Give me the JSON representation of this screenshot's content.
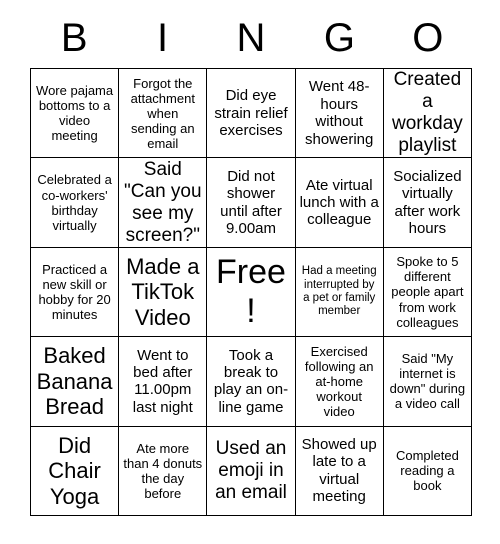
{
  "card": {
    "title": "BINGO",
    "header_letters": [
      "B",
      "I",
      "N",
      "G",
      "O"
    ],
    "colors": {
      "background": "#ffffff",
      "text": "#000000",
      "grid_line": "#000000"
    },
    "grid_size": "5x5",
    "free_space_index": 12,
    "cells": [
      {
        "text": "Wore pajama bottoms to a video meeting",
        "size": "sm"
      },
      {
        "text": "Forgot the attachment when sending an email",
        "size": "sm"
      },
      {
        "text": "Did eye strain relief exercises",
        "size": "md"
      },
      {
        "text": "Went 48-hours without showering",
        "size": "md"
      },
      {
        "text": "Created a workday playlist",
        "size": "lg"
      },
      {
        "text": "Celebrated a co-workers' birthday virtually",
        "size": "sm"
      },
      {
        "text": "Said \"Can you see my screen?\"",
        "size": "lg"
      },
      {
        "text": "Did not shower until after 9.00am",
        "size": "md"
      },
      {
        "text": "Ate virtual lunch with a colleague",
        "size": "md"
      },
      {
        "text": "Socialized virtually after work hours",
        "size": "md"
      },
      {
        "text": "Practiced a new skill or hobby for 20 minutes",
        "size": "sm"
      },
      {
        "text": "Made a TikTok Video",
        "size": "xl"
      },
      {
        "text": "Free!",
        "size": "xxl"
      },
      {
        "text": "Had a meeting interrupted by a pet or family member",
        "size": "xs"
      },
      {
        "text": "Spoke to 5 different people apart from work colleagues",
        "size": "sm"
      },
      {
        "text": "Baked Banana Bread",
        "size": "xl"
      },
      {
        "text": "Went to bed after 11.00pm last night",
        "size": "md"
      },
      {
        "text": "Took a break to play an on-line game",
        "size": "md"
      },
      {
        "text": "Exercised following an at-home workout video",
        "size": "sm"
      },
      {
        "text": "Said \"My internet is down\" during a video call",
        "size": "sm"
      },
      {
        "text": "Did Chair Yoga",
        "size": "xl"
      },
      {
        "text": "Ate more than 4 donuts the day before",
        "size": "sm"
      },
      {
        "text": "Used an emoji in an email",
        "size": "lg"
      },
      {
        "text": "Showed up late to a virtual meeting",
        "size": "md"
      },
      {
        "text": "Completed reading a book",
        "size": "sm"
      }
    ]
  }
}
